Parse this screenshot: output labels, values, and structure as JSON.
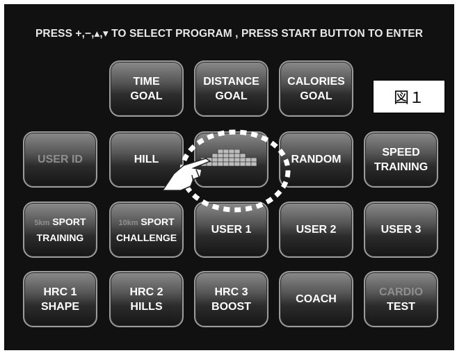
{
  "instruction": "PRESS +,−,▴,▾ TO SELECT PROGRAM , PRESS START BUTTON TO ENTER",
  "figure_label": "図１",
  "buttons": {
    "time_goal": {
      "line1": "TIME",
      "line2": "GOAL"
    },
    "distance_goal": {
      "line1": "DISTANCE",
      "line2": "GOAL"
    },
    "calories_goal": {
      "line1": "CALORIES",
      "line2": "GOAL"
    },
    "user_id": {
      "line1": "USER ID"
    },
    "hill": {
      "line1": "HILL"
    },
    "random": {
      "line1": "RANDOM"
    },
    "speed_training": {
      "line1": "SPEED",
      "line2": "TRAINING"
    },
    "sport_training": {
      "prefix": "5km",
      "line1": "SPORT",
      "line2": "TRAINING"
    },
    "sport_challenge": {
      "prefix": "10km",
      "line1": "SPORT",
      "line2": "CHALLENGE"
    },
    "user1": {
      "line1": "USER 1"
    },
    "user2": {
      "line1": "USER 2"
    },
    "user3": {
      "line1": "USER 3"
    },
    "hrc1": {
      "line1": "HRC 1",
      "line2": "SHAPE"
    },
    "hrc2": {
      "line1": "HRC 2",
      "line2": "HILLS"
    },
    "hrc3": {
      "line1": "HRC 3",
      "line2": "BOOST"
    },
    "coach": {
      "line1": "COACH"
    },
    "cardio_test": {
      "line1": "CARDIO",
      "line2": "TEST"
    }
  },
  "colors": {
    "screen_bg": "#111111",
    "button_text": "#ffffff",
    "dim_text": "#8f8f8f",
    "highlight_ring": "#ffffff"
  },
  "icons": {
    "custom_program": "bar-profile-icon",
    "pointer": "hand-pointer-icon"
  }
}
